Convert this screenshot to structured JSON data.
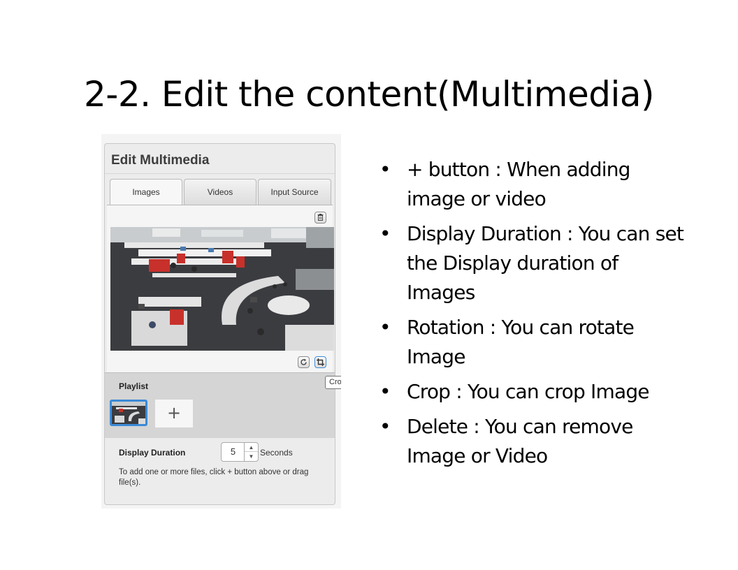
{
  "slide": {
    "title": "2-2. Edit the content(Multimedia)"
  },
  "panel": {
    "title": "Edit Multimedia",
    "tabs": [
      {
        "label": "Images",
        "active": true
      },
      {
        "label": "Videos",
        "active": false
      },
      {
        "label": "Input Source",
        "active": false
      }
    ],
    "playlist_label": "Playlist",
    "add_symbol": "+",
    "duration_label": "Display Duration",
    "duration_value": "5",
    "duration_unit": "Seconds",
    "hint": "To add one or more files, click + button above or drag file(s).",
    "tooltip": "Crop",
    "icons": {
      "delete": "trash-icon",
      "rotate": "rotate-icon",
      "crop": "crop-icon"
    },
    "accent_color": "#3a8ad6"
  },
  "bullets": [
    "+ button : When adding image or video",
    "Display Duration : You can set the Display duration of Images",
    "Rotation : You can rotate Image",
    "Crop : You can crop Image",
    "Delete : You can remove Image or Video"
  ]
}
